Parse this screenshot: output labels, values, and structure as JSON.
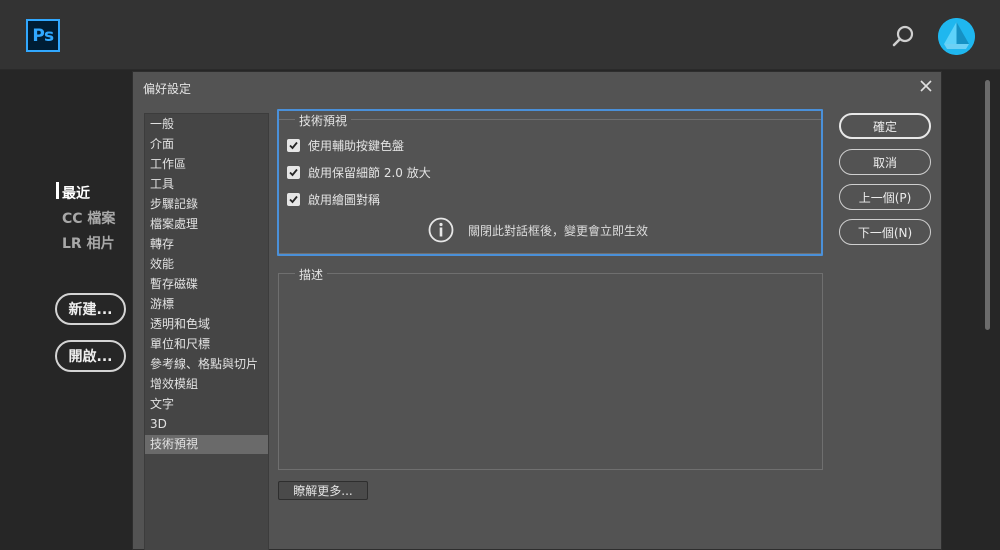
{
  "app": {
    "logo_text": "Ps",
    "brand_color": "#31a8ff",
    "search_icon": "search-icon",
    "avatar_color": "#1fb7ef"
  },
  "home": {
    "nav": [
      {
        "label": "最近",
        "active": true
      },
      {
        "label": "CC 檔案",
        "active": false
      },
      {
        "label": "LR 相片",
        "active": false
      }
    ],
    "buttons": {
      "new_label": "新建...",
      "open_label": "開啟..."
    }
  },
  "dialog": {
    "title": "偏好設定",
    "close_icon": "close-icon",
    "categories": [
      "一般",
      "介面",
      "工作區",
      "工具",
      "步驟記錄",
      "檔案處理",
      "轉存",
      "效能",
      "暫存磁碟",
      "游標",
      "透明和色域",
      "單位和尺標",
      "參考線、格點與切片",
      "增效模組",
      "文字",
      "3D",
      "技術預視"
    ],
    "selected_category": "技術預視",
    "preview_group": {
      "label": "技術預視",
      "checkboxes": [
        {
          "label": "使用輔助按鍵色盤",
          "checked": true
        },
        {
          "label": "啟用保留細節 2.0 放大",
          "checked": true
        },
        {
          "label": "啟用繪圖對稱",
          "checked": true
        }
      ],
      "info_text": "關閉此對話框後，變更會立即生效"
    },
    "description_group": {
      "label": "描述"
    },
    "learn_more_label": "瞭解更多...",
    "actions": {
      "ok_label": "確定",
      "cancel_label": "取消",
      "prev_label": "上一個(P)",
      "next_label": "下一個(N)"
    },
    "focus_color": "#4a90d9"
  }
}
